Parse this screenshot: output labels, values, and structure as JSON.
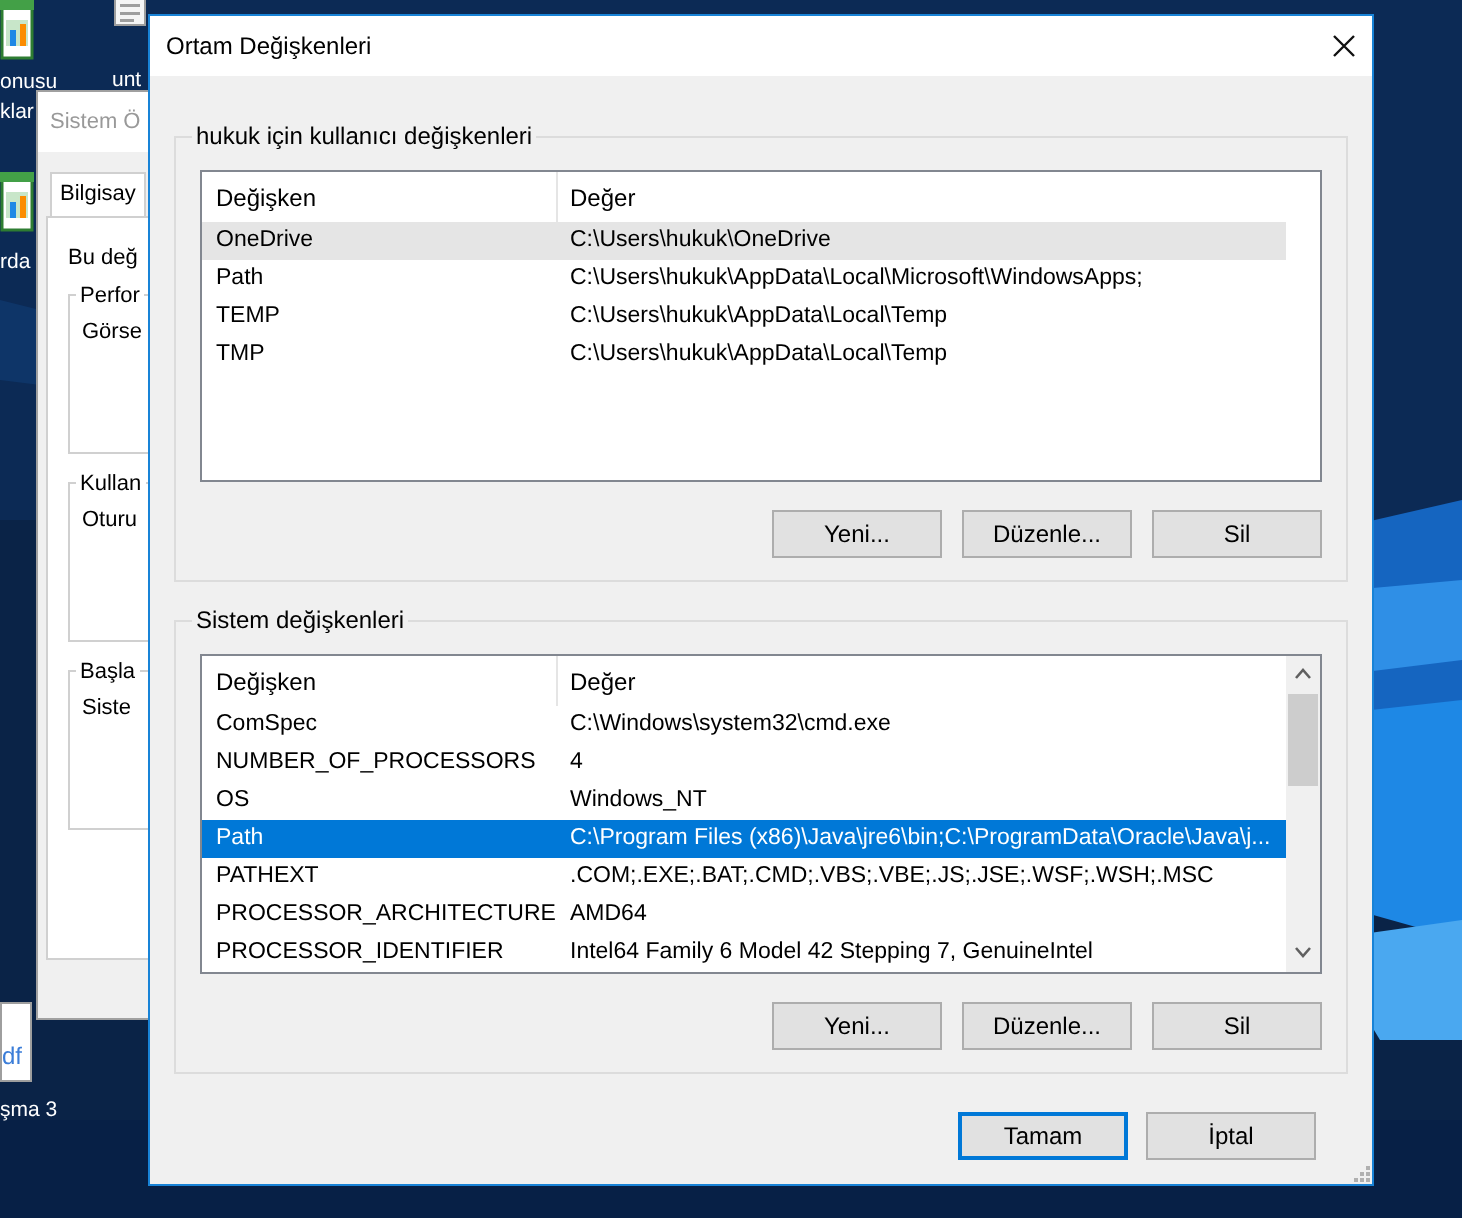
{
  "desktop": {
    "icons": [
      {
        "kind": "sheet",
        "labels": [
          "onusu",
          "klar"
        ]
      },
      {
        "kind": "document",
        "labels": [
          "unt"
        ]
      },
      {
        "kind": "sheet",
        "labels": [
          "rda"
        ]
      },
      {
        "kind": "pdf",
        "badge": "df",
        "labels": [
          "şma 3"
        ]
      }
    ]
  },
  "back_window": {
    "title": "Sistem Ö",
    "tab": "Bilgisay",
    "intro": "Bu değ",
    "groups": [
      {
        "title": "Perfor",
        "text": "Görse"
      },
      {
        "title": "Kullan",
        "text": "Oturu"
      },
      {
        "title": "Başla",
        "text": "Siste"
      }
    ]
  },
  "window": {
    "title": "Ortam Değişkenleri"
  },
  "sections": [
    {
      "title": "hukuk için kullanıcı değişkenleri",
      "focused": false,
      "scrollbar": false,
      "columns": [
        "Değişken",
        "Değer"
      ],
      "rows": [
        {
          "name": "OneDrive",
          "value": "C:\\Users\\hukuk\\OneDrive",
          "selected": true
        },
        {
          "name": "Path",
          "value": "C:\\Users\\hukuk\\AppData\\Local\\Microsoft\\WindowsApps;",
          "selected": false
        },
        {
          "name": "TEMP",
          "value": "C:\\Users\\hukuk\\AppData\\Local\\Temp",
          "selected": false
        },
        {
          "name": "TMP",
          "value": "C:\\Users\\hukuk\\AppData\\Local\\Temp",
          "selected": false
        }
      ],
      "buttons": [
        "Yeni...",
        "Düzenle...",
        "Sil"
      ]
    },
    {
      "title": "Sistem değişkenleri",
      "focused": true,
      "scrollbar": true,
      "columns": [
        "Değişken",
        "Değer"
      ],
      "rows": [
        {
          "name": "ComSpec",
          "value": "C:\\Windows\\system32\\cmd.exe",
          "selected": false
        },
        {
          "name": "NUMBER_OF_PROCESSORS",
          "value": "4",
          "selected": false
        },
        {
          "name": "OS",
          "value": "Windows_NT",
          "selected": false
        },
        {
          "name": "Path",
          "value": "C:\\Program Files (x86)\\Java\\jre6\\bin;C:\\ProgramData\\Oracle\\Java\\j...",
          "selected": true
        },
        {
          "name": "PATHEXT",
          "value": ".COM;.EXE;.BAT;.CMD;.VBS;.VBE;.JS;.JSE;.WSF;.WSH;.MSC",
          "selected": false
        },
        {
          "name": "PROCESSOR_ARCHITECTURE",
          "value": "AMD64",
          "selected": false
        },
        {
          "name": "PROCESSOR_IDENTIFIER",
          "value": "Intel64 Family 6 Model 42 Stepping 7, GenuineIntel",
          "selected": false
        }
      ],
      "buttons": [
        "Yeni...",
        "Düzenle...",
        "Sil"
      ]
    }
  ],
  "footer_buttons": [
    {
      "label": "Tamam",
      "default": true
    },
    {
      "label": "İptal",
      "default": false
    }
  ]
}
